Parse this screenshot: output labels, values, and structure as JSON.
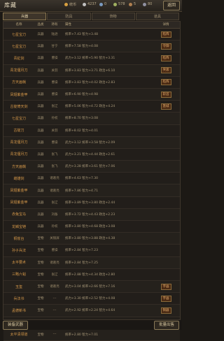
{
  "header": {
    "title": "库藏",
    "resources": [
      {
        "icon": "coin-icon",
        "color": "#d8a040",
        "value": "统币"
      },
      {
        "icon": "silver-icon",
        "color": "#c0c0c0",
        "value": "4237"
      },
      {
        "icon": "gem-icon",
        "color": "#7a9ac0",
        "value": "0"
      },
      {
        "icon": "food-icon",
        "color": "#a0b060",
        "value": "578"
      },
      {
        "icon": "wood-icon",
        "color": "#b08050",
        "value": "5"
      },
      {
        "icon": "iron-icon",
        "color": "#9090a0",
        "value": "80"
      }
    ],
    "back_label": "返回"
  },
  "tabs": [
    {
      "label": "兵器"
    },
    {
      "label": "防具"
    },
    {
      "label": "饰物"
    },
    {
      "label": "道具"
    }
  ],
  "table": {
    "headers": [
      "名称",
      "品类",
      "持有",
      "属性",
      "详情"
    ],
    "rows": [
      {
        "name": "七星宝刀",
        "type": "兵器",
        "owner": "陆逊",
        "attr": "统率+7.43 智力+3.48",
        "tag": "陷阵"
      },
      {
        "name": "七星宝刀",
        "type": "兵器",
        "owner": "甘宁",
        "attr": "统率+7.58 智力+4.08",
        "tag": "守御"
      },
      {
        "name": "青釭剑",
        "type": "兵器",
        "owner": "曹操",
        "attr": "武力+3.12 统率+5.90 智力+3.31",
        "tag": "陷阵"
      },
      {
        "name": "青龙偃月刀",
        "type": "兵器",
        "owner": "关羽",
        "attr": "统率+3.83 智力+3.71 政治+6.10",
        "tag": "突袭"
      },
      {
        "name": "方天画戟",
        "type": "兵器",
        "owner": "曹操",
        "attr": "统率+3.83 智力+4.02 政治+2.83",
        "tag": "陷阵"
      },
      {
        "name": "凤翅紫金甲",
        "type": "兵器",
        "owner": "曹操",
        "attr": "统率+6.90 智力+4.98",
        "tag": "斩首"
      },
      {
        "name": "古锭倚天剑",
        "type": "兵器",
        "owner": "张辽",
        "attr": "统率+5.06 智力+4.72 政治+4.24",
        "tag": "轰城"
      },
      {
        "name": "七星宝刀",
        "type": "兵器",
        "owner": "孙权",
        "attr": "统率+8.70 智力+3.08",
        "tag": ""
      },
      {
        "name": "古锭刀",
        "type": "兵器",
        "owner": "关羽",
        "attr": "统率+8.02 智力+4.01",
        "tag": ""
      },
      {
        "name": "青龙偃月刀",
        "type": "兵器",
        "owner": "曹操",
        "attr": "武力+3.12 统率+3.58 智力+2.09",
        "tag": ""
      },
      {
        "name": "青龙偃月刀",
        "type": "兵器",
        "owner": "张飞",
        "attr": "武力+3.21 智力+4.44 政治+2.61",
        "tag": ""
      },
      {
        "name": "方天画戟",
        "type": "兵器",
        "owner": "张飞",
        "attr": "武力+3.28 统率+3.61 智力+7.06",
        "tag": ""
      },
      {
        "name": "雌雄剑",
        "type": "兵器",
        "owner": "诸葛亮",
        "attr": "统率+4.63 智力+7.30",
        "tag": ""
      },
      {
        "name": "凤翅紫金甲",
        "type": "兵器",
        "owner": "诸葛亮",
        "attr": "统率+7.86 智力+4.71",
        "tag": ""
      },
      {
        "name": "凤翅紫金甲",
        "type": "兵器",
        "owner": "张辽",
        "attr": "统率+3.89 智力+3.80 政治+2.44",
        "tag": ""
      },
      {
        "name": "赤兔宝马",
        "type": "兵器",
        "owner": "刘备",
        "attr": "统率+3.72 智力+4.43 政治+2.23",
        "tag": ""
      },
      {
        "name": "龙鳞宝铠",
        "type": "兵器",
        "owner": "孙权",
        "attr": "统率+3.80 智力+4.68 政治+3.08",
        "tag": ""
      },
      {
        "name": "铜雀台",
        "type": "宝物",
        "owner": "关银屏",
        "attr": "统率+3.80 智力+3.88 政治+4.38",
        "tag": ""
      },
      {
        "name": "孙子兵法",
        "type": "宝物",
        "owner": "曹操",
        "attr": "统率+2.84 智力+7.23",
        "tag": ""
      },
      {
        "name": "太平要术",
        "type": "宝物",
        "owner": "诸葛亮",
        "attr": "统率+2.84 智力+7.25",
        "tag": ""
      },
      {
        "name": "三略六韬",
        "type": "宝物",
        "owner": "张辽",
        "attr": "统率+2.88 智力+4.34 政治+2.80",
        "tag": ""
      },
      {
        "name": "玉玺",
        "type": "宝物",
        "owner": "诸葛亮",
        "attr": "武力+3.04 统率+2.66 智力+7.16",
        "tag": "字画"
      },
      {
        "name": "兵法书",
        "type": "宝物",
        "owner": "---",
        "attr": "武力+3.30 统率+2.52 智力+4.08",
        "tag": "字画"
      },
      {
        "name": "孟德新书",
        "type": "宝物",
        "owner": "---",
        "attr": "武力+2.92 统率+2.24 智力+4.64",
        "tag": "铜器"
      },
      {
        "name": "六韬",
        "type": "宝物",
        "owner": "---",
        "attr": "武力+3.60 统率+2.46 智力+5.16",
        "tag": ""
      },
      {
        "name": "太平清领道",
        "type": "宝物",
        "owner": "---",
        "attr": "统率+2.80 智力+7.01",
        "tag": ""
      }
    ]
  },
  "footer": {
    "left_label": "装备武器",
    "right_label": "批量出售"
  }
}
